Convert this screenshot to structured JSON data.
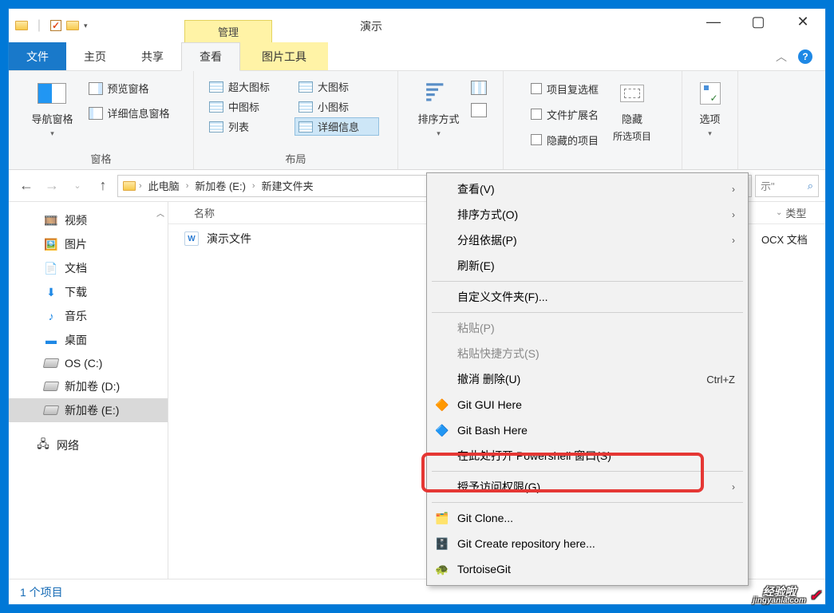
{
  "window": {
    "title_contextual_tab": "管理",
    "title_text": "演示"
  },
  "ribbon": {
    "tabs": {
      "file": "文件",
      "home": "主页",
      "share": "共享",
      "view": "查看",
      "contextual": "图片工具"
    },
    "groups": {
      "panes": {
        "label": "窗格",
        "nav": "导航窗格",
        "preview": "预览窗格",
        "details": "详细信息窗格"
      },
      "layout": {
        "label": "布局",
        "xl_icons": "超大图标",
        "l_icons": "大图标",
        "m_icons": "中图标",
        "s_icons": "小图标",
        "list": "列表",
        "details": "详细信息"
      },
      "sort": {
        "sort_label": "排序方式"
      },
      "showhide": {
        "item_checkboxes": "项目复选框",
        "file_ext": "文件扩展名",
        "hidden_items": "隐藏的项目",
        "hide_btn": "隐藏",
        "hide_sub": "所选项目"
      },
      "options": {
        "options_label": "选项"
      }
    }
  },
  "breadcrumb": {
    "c0": "此电脑",
    "c1": "新加卷 (E:)",
    "c2": "新建文件夹"
  },
  "search": {
    "suffix": "示\""
  },
  "sidebar": {
    "videos": "视频",
    "pictures": "图片",
    "documents": "文档",
    "downloads": "下载",
    "music": "音乐",
    "desktop": "桌面",
    "os_c": "OS (C:)",
    "vol_d": "新加卷 (D:)",
    "vol_e": "新加卷 (E:)",
    "network": "网络"
  },
  "file_list": {
    "columns": {
      "name": "名称",
      "type_partial": "类型"
    },
    "row0": {
      "name": "演示文件",
      "type_partial": "OCX 文档"
    }
  },
  "context_menu": {
    "view": "查看(V)",
    "sort": "排序方式(O)",
    "group": "分组依据(P)",
    "refresh": "刷新(E)",
    "customize": "自定义文件夹(F)...",
    "paste": "粘贴(P)",
    "paste_shortcut": "粘贴快捷方式(S)",
    "undo": "撤消 删除(U)",
    "undo_sc": "Ctrl+Z",
    "git_gui": "Git GUI Here",
    "git_bash": "Git Bash Here",
    "powershell": "在此处打开 Powershell 窗口(S)",
    "grant_access": "授予访问权限(G)",
    "git_clone": "Git Clone...",
    "git_create": "Git Create repository here...",
    "tortoise": "TortoiseGit"
  },
  "status_bar": {
    "count": "1 个项目"
  },
  "watermark": {
    "text_cn": "经验啦",
    "text_en": "jingyanla.com"
  }
}
